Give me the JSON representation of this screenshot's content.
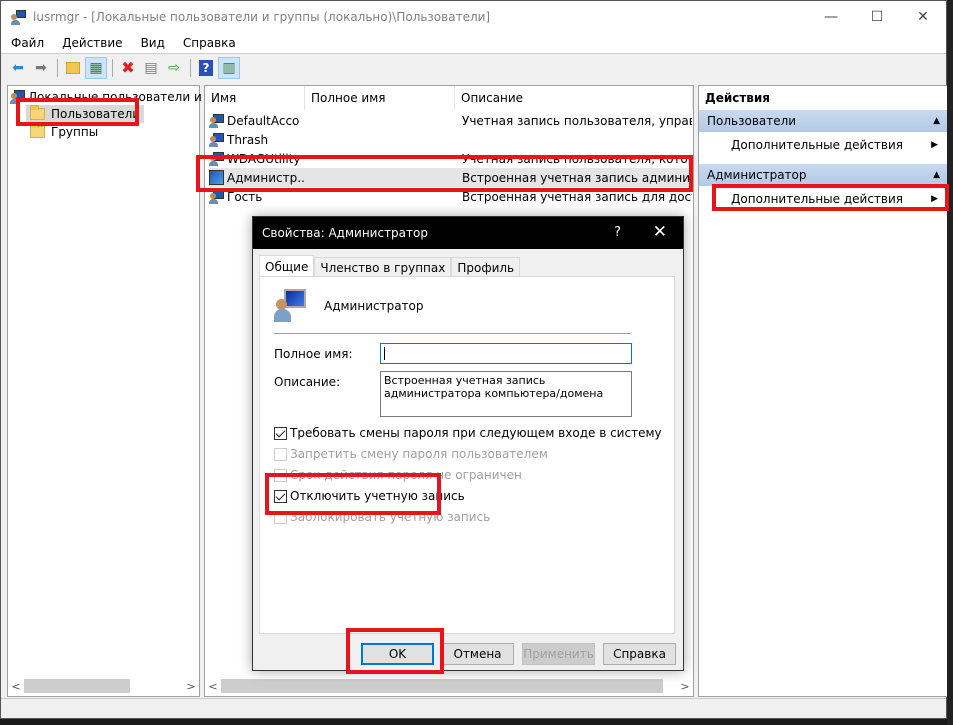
{
  "window": {
    "title": "lusrmgr - [Локальные пользователи и группы (локально)\\Пользователи]",
    "controls": {
      "minimize": "—",
      "maximize": "☐",
      "close": "✕"
    }
  },
  "menu": [
    "Файл",
    "Действие",
    "Вид",
    "Справка"
  ],
  "toolbar": [
    {
      "icon": "back-arrow-icon",
      "glyph": "⬅"
    },
    {
      "icon": "forward-arrow-icon",
      "glyph": "➡"
    },
    {
      "icon": "up-folder-icon",
      "glyph": "📁"
    },
    {
      "icon": "show-hide-tree-icon",
      "glyph": "▦"
    },
    {
      "icon": "delete-icon",
      "glyph": "✖"
    },
    {
      "icon": "properties-icon",
      "glyph": "▤"
    },
    {
      "icon": "export-list-icon",
      "glyph": "⇨"
    },
    {
      "icon": "help-icon",
      "glyph": "?"
    },
    {
      "icon": "show-hide-action-pane-icon",
      "glyph": "▥"
    }
  ],
  "tree": {
    "root": "Локальные пользователи и группы (локально)",
    "items": [
      {
        "label": "Пользователи",
        "selected": true
      },
      {
        "label": "Группы",
        "selected": false
      }
    ]
  },
  "list": {
    "columns": [
      "Имя",
      "Полное имя",
      "Описание"
    ],
    "rows": [
      {
        "name": "DefaultAcco",
        "full_name": "",
        "description": "Учетная запись пользователя, управляе..."
      },
      {
        "name": "Thrash",
        "full_name": "",
        "description": ""
      },
      {
        "name": "WDAGUtility",
        "full_name": "",
        "description": "Учетная запись пользователя, которую..."
      },
      {
        "name": "Администр...",
        "full_name": "",
        "description": "Встроенная учетная запись администрат..."
      },
      {
        "name": "Гость",
        "full_name": "",
        "description": "Встроенная учетная запись для доступа г..."
      }
    ]
  },
  "actions": {
    "title": "Действия",
    "groups": [
      {
        "label": "Пользователи",
        "items": [
          "Дополнительные действия"
        ]
      },
      {
        "label": "Администратор",
        "items": [
          "Дополнительные действия"
        ]
      }
    ]
  },
  "dialog": {
    "title": "Свойства: Администратор",
    "help_glyph": "?",
    "close_glyph": "✕",
    "tabs": [
      "Общие",
      "Членство в группах",
      "Профиль"
    ],
    "active_tab": "Общие",
    "user_name": "Администратор",
    "full_name_label": "Полное имя:",
    "full_name_value": "",
    "description_label": "Описание:",
    "description_value": "Встроенная учетная запись администратора компьютера/домена",
    "checkboxes": [
      {
        "label": "Требовать смены пароля при следующем входе в систему",
        "checked": true,
        "enabled": true
      },
      {
        "label": "Запретить смену пароля пользователем",
        "checked": false,
        "enabled": false
      },
      {
        "label": "Срок действия пароля не ограничен",
        "checked": false,
        "enabled": false
      },
      {
        "label": "Отключить учетную запись",
        "checked": true,
        "enabled": true
      },
      {
        "label": "Заблокировать учетную запись",
        "checked": false,
        "enabled": false
      }
    ],
    "buttons": {
      "ok": "OK",
      "cancel": "Отмена",
      "apply": "Применить",
      "help": "Справка"
    }
  },
  "highlight_color": "#e8141c"
}
